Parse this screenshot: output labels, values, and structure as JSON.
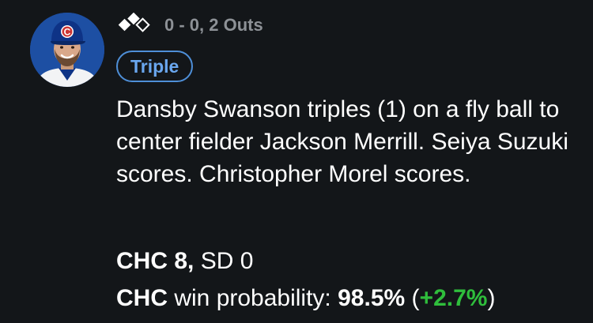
{
  "player": {
    "avatar_icon": "player-headshot",
    "cap_letter": "C"
  },
  "play": {
    "bases_icon": "bases-diamond-icon",
    "situation": "0 - 0, 2 Outs",
    "badge": "Triple",
    "description": "Dansby Swanson triples (1) on a fly ball to center fielder Jackson Merrill. Seiya Suzuki scores. Christopher Morel scores."
  },
  "score": {
    "home_team": "CHC",
    "home_score": "8",
    "separator": ",",
    "away_team": "SD",
    "away_score": "0"
  },
  "win_probability": {
    "team": "CHC",
    "label": "win probability:",
    "value": "98.5%",
    "open_paren": "(",
    "change": "+2.7%",
    "close_paren": ")"
  },
  "colors": {
    "background": "#131619",
    "badge_accent": "#4e8fd8",
    "positive_change": "#2fbe3c",
    "muted_text": "#8d9196"
  }
}
